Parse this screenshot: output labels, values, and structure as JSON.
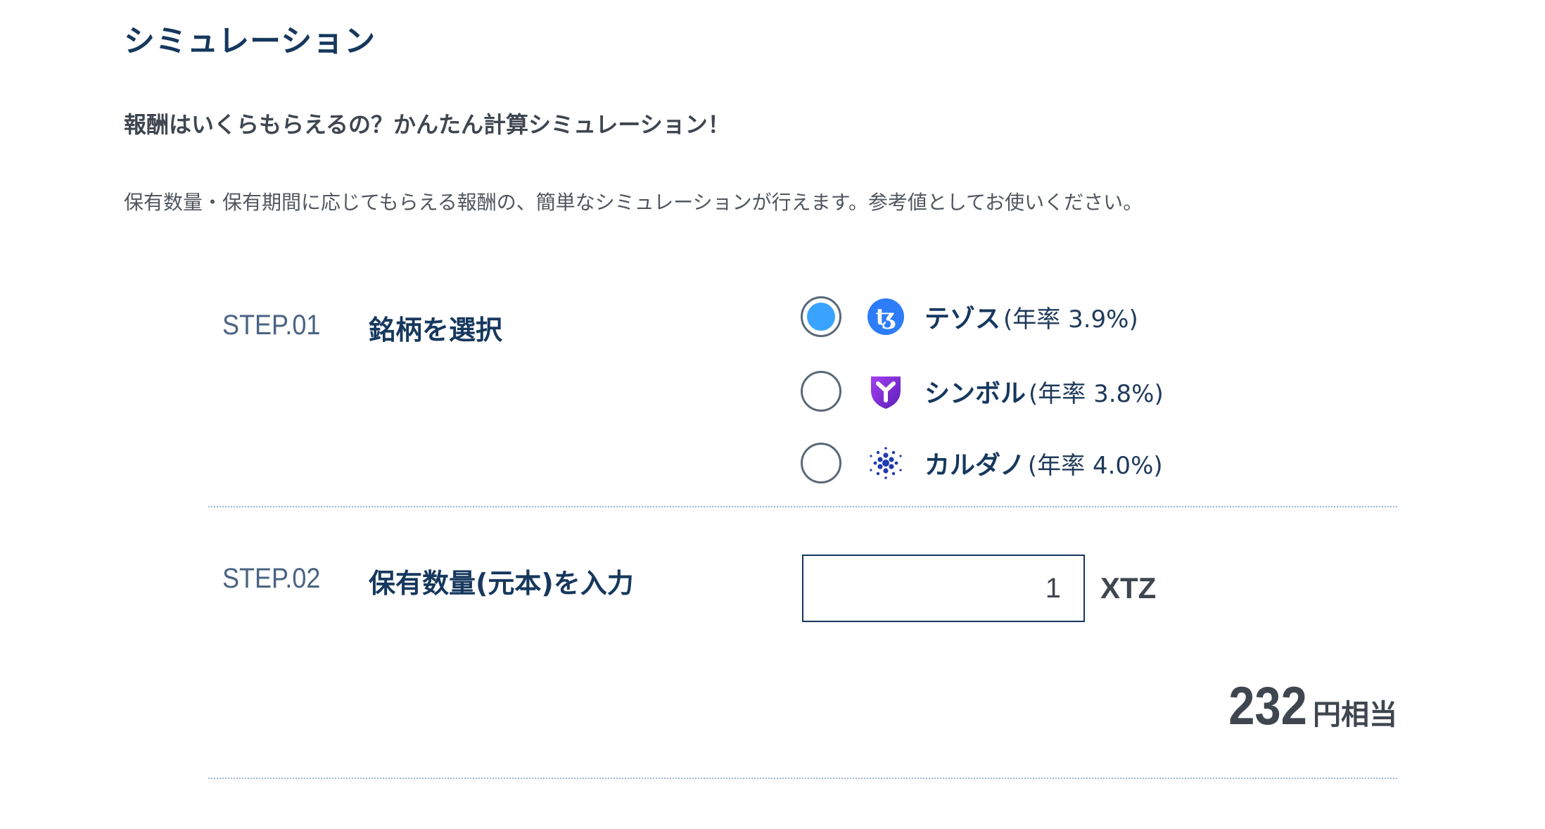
{
  "header": {
    "title": "シミュレーション",
    "subtitle": "報酬はいくらもらえるの？かんたん計算シミュレーション！",
    "description": "保有数量・保有期間に応じてもらえる報酬の、簡単なシミュレーションが行えます。参考値としてお使いください。"
  },
  "step1": {
    "label": "STEP.01",
    "title": "銘柄を選択",
    "options": [
      {
        "name": "テゾス",
        "rate": "(年率 3.9%)",
        "icon": "tezos-icon",
        "selected": true
      },
      {
        "name": "シンボル",
        "rate": "(年率 3.8%)",
        "icon": "symbol-icon",
        "selected": false
      },
      {
        "name": "カルダノ",
        "rate": "(年率 4.0%)",
        "icon": "cardano-icon",
        "selected": false
      }
    ]
  },
  "step2": {
    "label": "STEP.02",
    "title": "保有数量(元本)を入力",
    "input_value": "1",
    "unit": "XTZ"
  },
  "result": {
    "value": "232",
    "unit": "円相当"
  },
  "colors": {
    "heading": "#16385e",
    "accent_radio": "#3aa3ff",
    "tezos": "#2c7df7",
    "symbol": "#7b2fd6",
    "cardano": "#1f3bb0",
    "divider": "#9db3cf"
  }
}
